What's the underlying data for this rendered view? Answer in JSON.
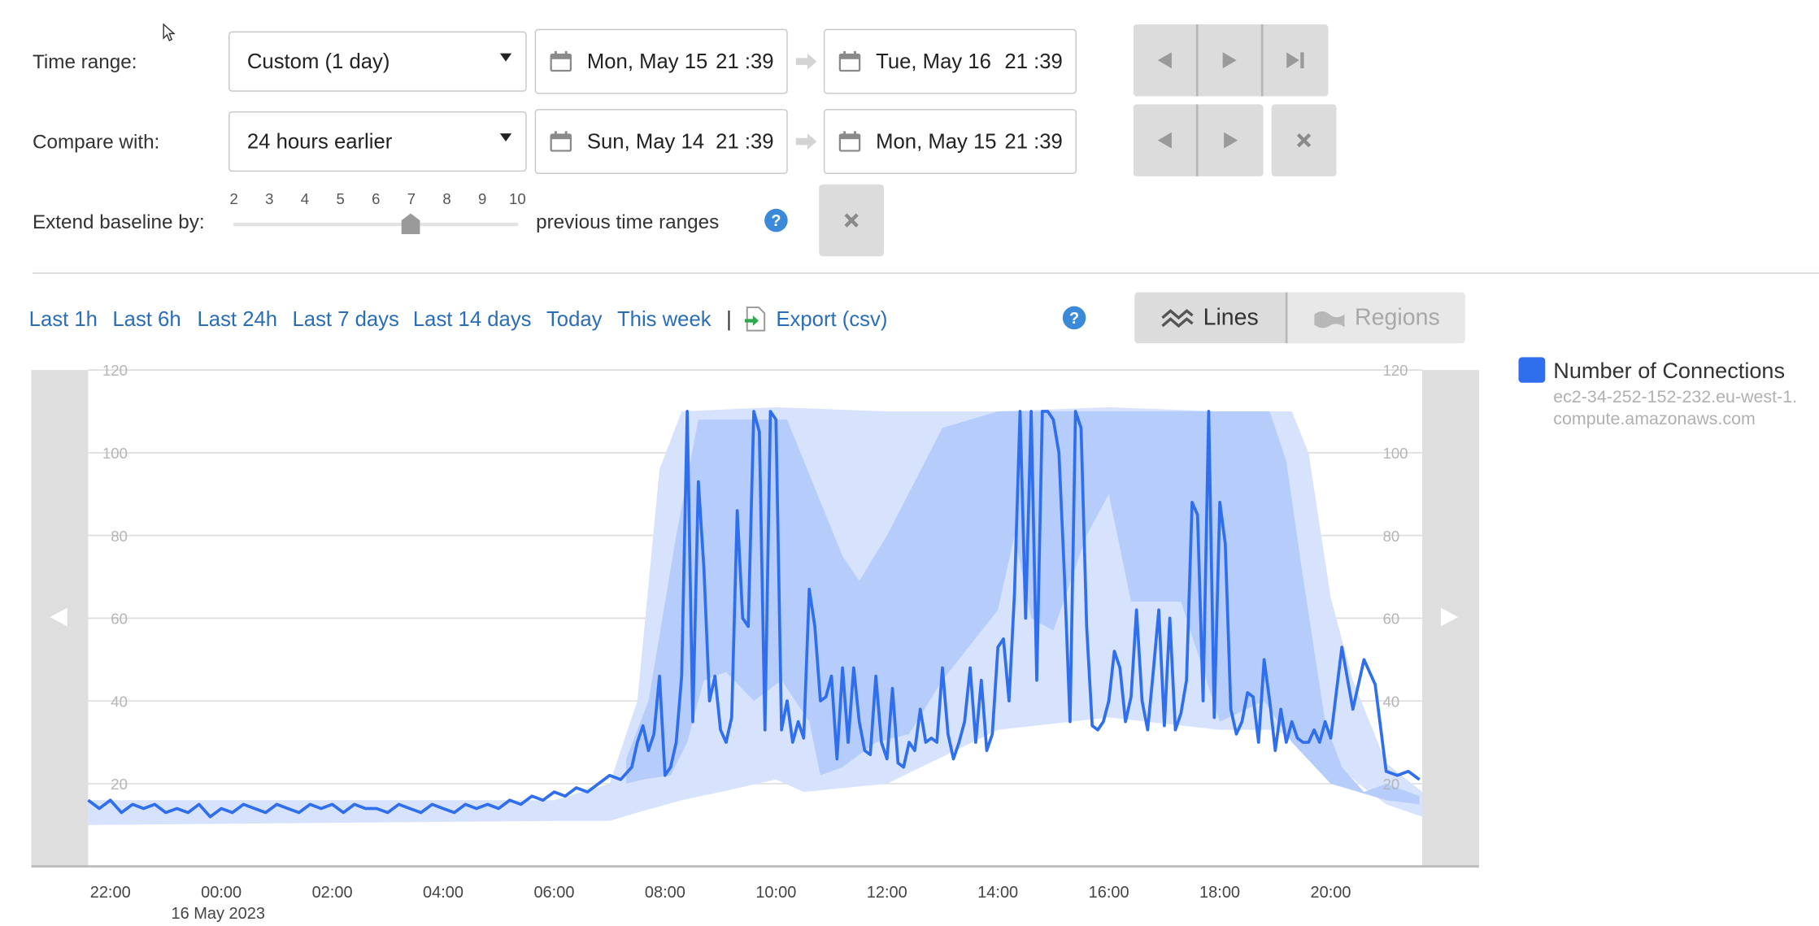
{
  "controls": {
    "time_range_label": "Time range:",
    "time_range_value": "Custom (1 day)",
    "range_start_date": "Mon, May 15",
    "range_start_time": "21 :39",
    "range_end_date": "Tue, May 16",
    "range_end_time": "21 :39",
    "compare_label": "Compare with:",
    "compare_value": "24 hours earlier",
    "compare_start_date": "Sun, May 14",
    "compare_start_time": "21 :39",
    "compare_end_date": "Mon, May 15",
    "compare_end_time": "21 :39",
    "baseline_label": "Extend baseline by:",
    "baseline_ticks": [
      "2",
      "3",
      "4",
      "5",
      "6",
      "7",
      "8",
      "9",
      "10"
    ],
    "baseline_value": 7,
    "baseline_suffix": "previous time ranges"
  },
  "quick_links": {
    "last_1h": "Last 1h",
    "last_6h": "Last 6h",
    "last_24h": "Last 24h",
    "last_7d": "Last 7 days",
    "last_14d": "Last 14 days",
    "today": "Today",
    "this_week": "This week",
    "separator": "|",
    "export": "Export (csv)"
  },
  "view_toggle": {
    "lines": "Lines",
    "regions": "Regions",
    "selected": "Lines"
  },
  "legend": {
    "series_name": "Number of Connections",
    "host": "ec2-34-252-152-232.eu-west-1.compute.amazonaws.com",
    "color": "#2f6fed"
  },
  "icons": {
    "calendar": "calendar-icon",
    "arrow": "arrow-right-icon",
    "prev": "step-back-icon",
    "next": "step-forward-icon",
    "last": "skip-to-end-icon",
    "close": "close-icon",
    "help": "help-icon",
    "export": "export-file-icon",
    "lines": "lines-icon",
    "regions": "regions-icon",
    "scroll_left": "scroll-left-icon",
    "scroll_right": "scroll-right-icon"
  },
  "chart_data": {
    "type": "line",
    "title": "",
    "ylim": [
      0,
      120
    ],
    "y_ticks": [
      20,
      40,
      60,
      80,
      100,
      120
    ],
    "x_ticks": [
      "22:00",
      "00:00",
      "02:00",
      "04:00",
      "06:00",
      "08:00",
      "10:00",
      "12:00",
      "14:00",
      "16:00",
      "18:00",
      "20:00"
    ],
    "x_sublabel": "16 May 2023",
    "x_range_hours": [
      -2.4,
      21.65
    ],
    "grid": "horizontal",
    "colors": {
      "line": "#2f6fed",
      "band_outer": "#d7e3fd",
      "band_inner": "#b6cdfb"
    },
    "series": [
      {
        "name": "Number of Connections",
        "x_hours": [
          -2.4,
          -2.2,
          -2.0,
          -1.8,
          -1.6,
          -1.4,
          -1.2,
          -1.0,
          -0.8,
          -0.6,
          -0.4,
          -0.2,
          0.0,
          0.2,
          0.4,
          0.6,
          0.8,
          1.0,
          1.2,
          1.4,
          1.6,
          1.8,
          2.0,
          2.2,
          2.4,
          2.6,
          2.8,
          3.0,
          3.2,
          3.4,
          3.6,
          3.8,
          4.0,
          4.2,
          4.4,
          4.6,
          4.8,
          5.0,
          5.2,
          5.4,
          5.6,
          5.8,
          6.0,
          6.2,
          6.4,
          6.6,
          6.8,
          7.0,
          7.2,
          7.4,
          7.5,
          7.6,
          7.7,
          7.8,
          7.9,
          8.0,
          8.1,
          8.2,
          8.3,
          8.4,
          8.5,
          8.6,
          8.7,
          8.8,
          8.9,
          9.0,
          9.1,
          9.2,
          9.3,
          9.4,
          9.5,
          9.6,
          9.7,
          9.8,
          9.9,
          10.0,
          10.1,
          10.2,
          10.3,
          10.4,
          10.5,
          10.6,
          10.7,
          10.8,
          10.9,
          11.0,
          11.1,
          11.2,
          11.3,
          11.4,
          11.5,
          11.6,
          11.7,
          11.8,
          11.9,
          12.0,
          12.1,
          12.2,
          12.3,
          12.4,
          12.5,
          12.6,
          12.7,
          12.8,
          12.9,
          13.0,
          13.1,
          13.2,
          13.3,
          13.4,
          13.5,
          13.6,
          13.7,
          13.8,
          13.9,
          14.0,
          14.1,
          14.2,
          14.3,
          14.4,
          14.5,
          14.6,
          14.7,
          14.8,
          14.9,
          15.0,
          15.1,
          15.2,
          15.3,
          15.4,
          15.5,
          15.6,
          15.7,
          15.8,
          15.9,
          16.0,
          16.1,
          16.2,
          16.3,
          16.4,
          16.5,
          16.6,
          16.7,
          16.8,
          16.9,
          17.0,
          17.1,
          17.2,
          17.3,
          17.4,
          17.5,
          17.6,
          17.7,
          17.8,
          17.9,
          18.0,
          18.1,
          18.2,
          18.3,
          18.4,
          18.5,
          18.6,
          18.7,
          18.8,
          18.9,
          19.0,
          19.1,
          19.2,
          19.3,
          19.4,
          19.5,
          19.6,
          19.7,
          19.8,
          19.9,
          20.0,
          20.2,
          20.4,
          20.6,
          20.8,
          21.0,
          21.2,
          21.4,
          21.6
        ],
        "values": [
          16,
          14,
          16,
          13,
          15,
          14,
          15,
          13,
          14,
          13,
          15,
          12,
          14,
          13,
          15,
          14,
          13,
          15,
          14,
          13,
          15,
          14,
          15,
          13,
          15,
          14,
          14,
          13,
          15,
          14,
          13,
          15,
          14,
          13,
          15,
          14,
          15,
          14,
          16,
          15,
          17,
          16,
          18,
          17,
          19,
          18,
          20,
          22,
          21,
          24,
          30,
          34,
          28,
          32,
          46,
          22,
          24,
          30,
          46,
          110,
          35,
          93,
          72,
          40,
          46,
          33,
          30,
          36,
          86,
          60,
          58,
          110,
          105,
          33,
          110,
          108,
          33,
          40,
          30,
          35,
          31,
          67,
          58,
          40,
          41,
          46,
          26,
          48,
          30,
          48,
          35,
          28,
          27,
          46,
          30,
          26,
          43,
          25,
          24,
          30,
          28,
          38,
          30,
          31,
          30,
          48,
          32,
          26,
          30,
          35,
          48,
          30,
          45,
          28,
          32,
          53,
          55,
          40,
          66,
          110,
          60,
          110,
          45,
          110,
          110,
          108,
          100,
          70,
          35,
          110,
          106,
          58,
          34,
          33,
          35,
          40,
          52,
          48,
          35,
          41,
          62,
          40,
          33,
          47,
          62,
          34,
          60,
          33,
          37,
          45,
          88,
          85,
          40,
          110,
          36,
          88,
          78,
          38,
          32,
          35,
          42,
          41,
          30,
          50,
          40,
          28,
          38,
          30,
          35,
          31,
          30,
          30,
          33,
          30,
          35,
          31,
          53,
          38,
          50,
          44,
          23,
          22,
          23,
          21,
          19,
          18,
          16,
          17,
          15
        ]
      }
    ]
  }
}
